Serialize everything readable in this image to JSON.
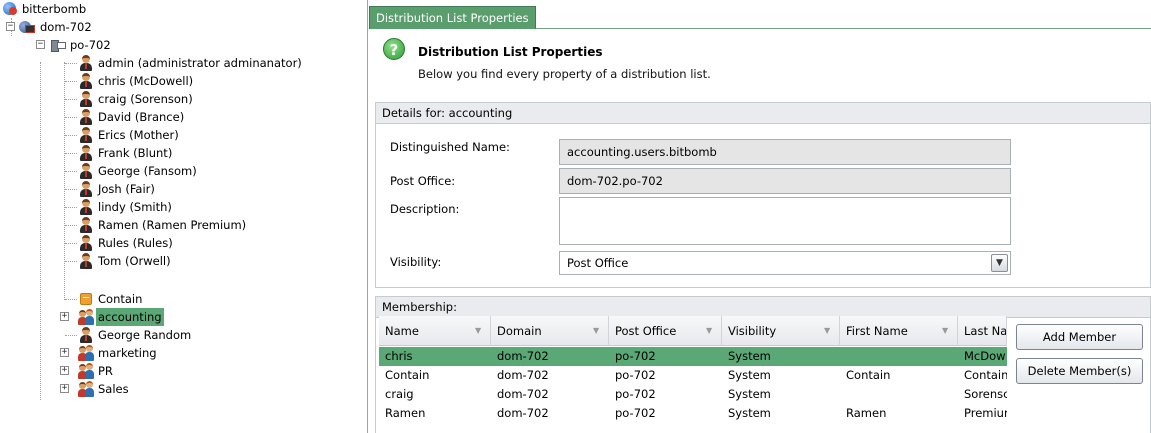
{
  "tree": {
    "root": "bitterbomb",
    "domain": "dom-702",
    "post_office": "po-702",
    "users": [
      "admin (administrator  adminanator)",
      "chris (McDowell)",
      "craig (Sorenson)",
      "David (Brance)",
      "Erics (Mother)",
      "Frank (Blunt)",
      "George (Fansom)",
      "Josh (Fair)",
      "lindy (Smith)",
      "Ramen (Ramen Premium)",
      "Rules (Rules)",
      "Tom (Orwell)"
    ],
    "resource": "Contain",
    "groups_a": "accounting",
    "user_b": "George Random",
    "groups_b": [
      "marketing",
      "PR",
      "Sales"
    ],
    "selected": "accounting"
  },
  "tab": {
    "label": "Distribution List Properties"
  },
  "header": {
    "title": "Distribution List Properties",
    "subtitle": "Below you find every property of a distribution list."
  },
  "details": {
    "section_title": "Details for: accounting",
    "distinguished_name_label": "Distinguished Name:",
    "distinguished_name_value": "accounting.users.bitbomb",
    "post_office_label": "Post Office:",
    "post_office_value": "dom-702.po-702",
    "description_label": "Description:",
    "description_value": "",
    "visibility_label": "Visibility:",
    "visibility_value": "Post Office"
  },
  "membership": {
    "section_title": "Membership:",
    "columns": [
      "Name",
      "Domain",
      "Post Office",
      "Visibility",
      "First Name",
      "Last Na"
    ],
    "rows": [
      [
        "chris",
        "dom-702",
        "po-702",
        "System",
        "",
        "McDow"
      ],
      [
        "Contain",
        "dom-702",
        "po-702",
        "System",
        "Contain",
        "Contain"
      ],
      [
        "craig",
        "dom-702",
        "po-702",
        "System",
        "",
        "Sorensc"
      ],
      [
        "Ramen",
        "dom-702",
        "po-702",
        "System",
        "Ramen",
        "Premiur"
      ]
    ],
    "selected_row": 0,
    "add_button": "Add Member",
    "delete_button": "Delete Member(s)"
  },
  "colors": {
    "selection": "#5aa876",
    "tab": "#5a9e6e",
    "section_header": "#e9ebee"
  }
}
